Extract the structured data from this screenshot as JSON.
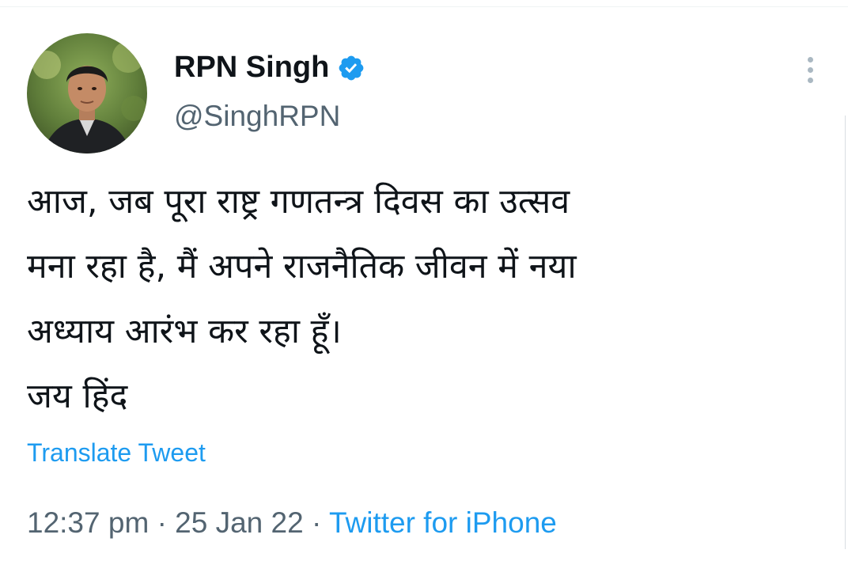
{
  "author": {
    "display_name": "RPN Singh",
    "handle": "@SinghRPN",
    "verified": true
  },
  "tweet": {
    "lines": [
      "आज, जब पूरा राष्ट्र गणतन्त्र दिवस का उत्सव",
      "मना रहा है, मैं अपने राजनैतिक जीवन में नया",
      "अध्याय आरंभ कर रहा हूँ।",
      "जय हिंद"
    ],
    "translate_label": "Translate Tweet"
  },
  "meta": {
    "time": "12:37 pm",
    "separator": "·",
    "date": "25 Jan 22",
    "source": "Twitter for iPhone"
  },
  "icons": {
    "verified": "verified-badge-icon",
    "more": "more-vertical-icon"
  },
  "colors": {
    "accent": "#1d9bf0",
    "secondary_text": "#536471",
    "primary_text": "#0f1419"
  }
}
